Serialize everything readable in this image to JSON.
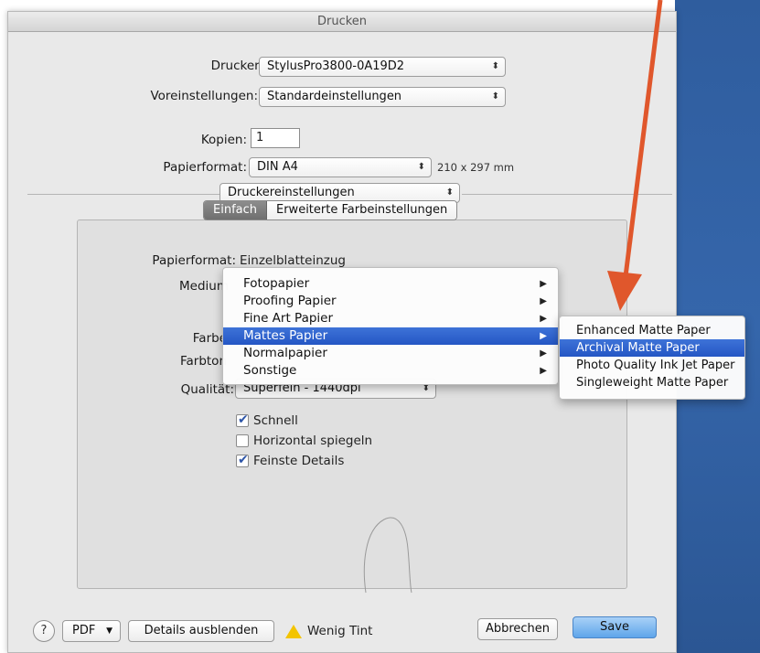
{
  "dialog": {
    "title": "Drucken"
  },
  "form": {
    "printer_label": "Drucker:",
    "printer_value": "StylusPro3800-0A19D2",
    "presets_label": "Voreinstellungen:",
    "presets_value": "Standardeinstellungen",
    "copies_label": "Kopien:",
    "copies_value": "1",
    "paper_label": "Papierformat:",
    "paper_value": "DIN A4",
    "paper_size": "210 x 297 mm",
    "section_value": "Druckereinstellungen"
  },
  "tabs": [
    {
      "label": "Einfach",
      "active": true
    },
    {
      "label": "Erweiterte Farbeinstellungen",
      "active": false
    }
  ],
  "panel": {
    "paper_format_label": "Papierformat:",
    "paper_format_value": "Einzelblatteinzug",
    "medium_label": "Medium",
    "farbe_label": "Farbe",
    "farbton_label": "Farbton",
    "quality_label": "Qualität:",
    "quality_value": "Superfein - 1440dpi"
  },
  "checkboxes": [
    {
      "label": "Schnell",
      "checked": true
    },
    {
      "label": "Horizontal spiegeln",
      "checked": false
    },
    {
      "label": "Feinste Details",
      "checked": true
    }
  ],
  "menu": {
    "items": [
      {
        "label": "Fotopapier",
        "selected": false
      },
      {
        "label": "Proofing Papier",
        "selected": false
      },
      {
        "label": "Fine Art Papier",
        "selected": false
      },
      {
        "label": "Mattes Papier",
        "selected": true
      },
      {
        "label": "Normalpapier",
        "selected": false
      },
      {
        "label": "Sonstige",
        "selected": false
      }
    ]
  },
  "submenu": {
    "items": [
      {
        "label": "Enhanced Matte Paper",
        "selected": false
      },
      {
        "label": "Archival Matte Paper",
        "selected": true
      },
      {
        "label": "Photo Quality Ink Jet Paper",
        "selected": false
      },
      {
        "label": "Singleweight Matte Paper",
        "selected": false
      }
    ]
  },
  "bottom": {
    "help_label": "?",
    "pdf_label": "PDF",
    "details_label": "Details ausblenden",
    "warning_label": "Wenig Tint",
    "cancel_label": "Abbrechen",
    "save_label": "Save"
  },
  "colors": {
    "accent": "#2d5fcc",
    "annotation_arrow": "#e0572c",
    "desk": "#3566ab"
  }
}
